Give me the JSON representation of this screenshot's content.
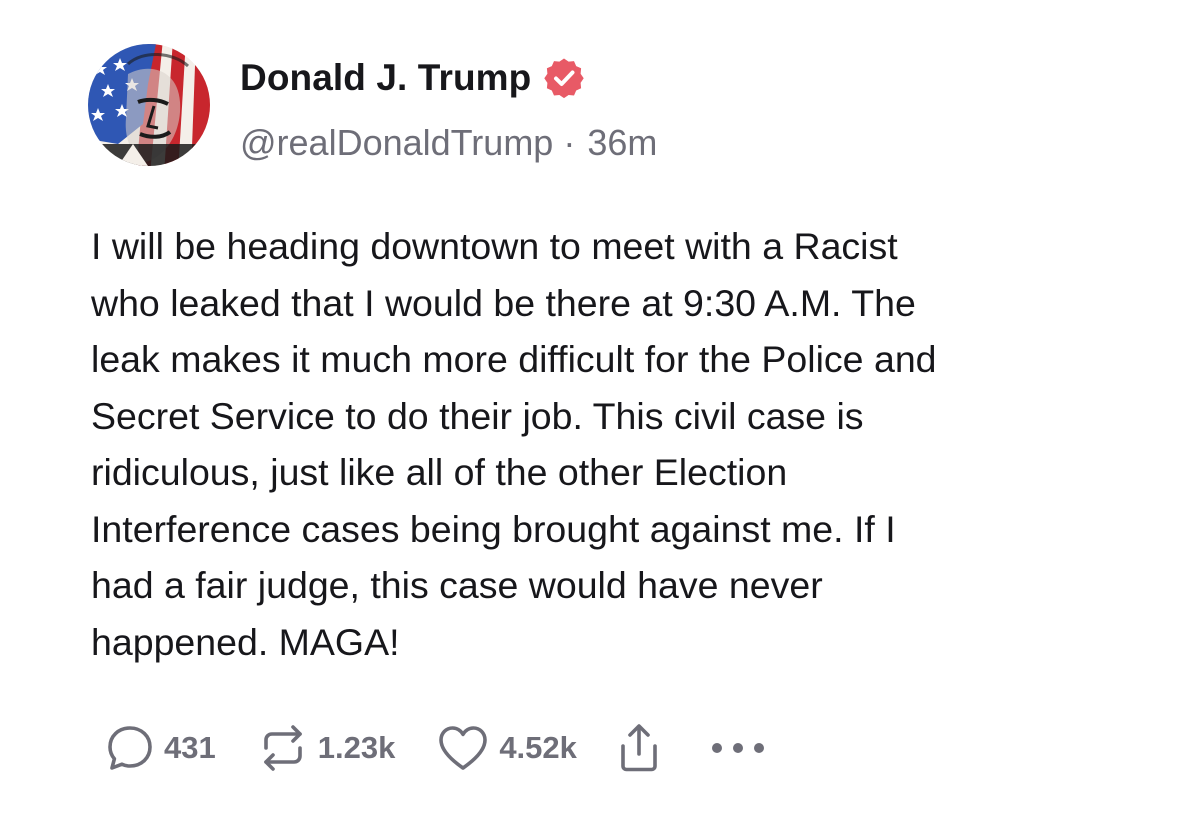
{
  "author": {
    "display_name": "Donald J. Trump",
    "handle": "@realDonaldTrump",
    "separator": "·",
    "time_ago": "36m",
    "verified_badge": "verified-check-icon"
  },
  "post": {
    "text": "I will be heading downtown to meet with a Racist\nwho leaked that I would be there at 9:30 A.M. The\nleak makes it much more difficult for the Police and\nSecret Service to do their job. This civil case is\nridiculous, just like all of the other Election\nInterference cases being brought against me. If I\nhad a fair judge, this case would have never\nhappened. MAGA!"
  },
  "actions": {
    "replies": "431",
    "reposts": "1.23k",
    "likes": "4.52k",
    "icons": [
      "reply-bubble-icon",
      "repost-icon",
      "heart-icon",
      "share-icon",
      "more-icon"
    ]
  },
  "colors": {
    "text": "#17171b",
    "muted": "#6e6e78",
    "badge": "#e85a66",
    "background": "#ffffff"
  }
}
